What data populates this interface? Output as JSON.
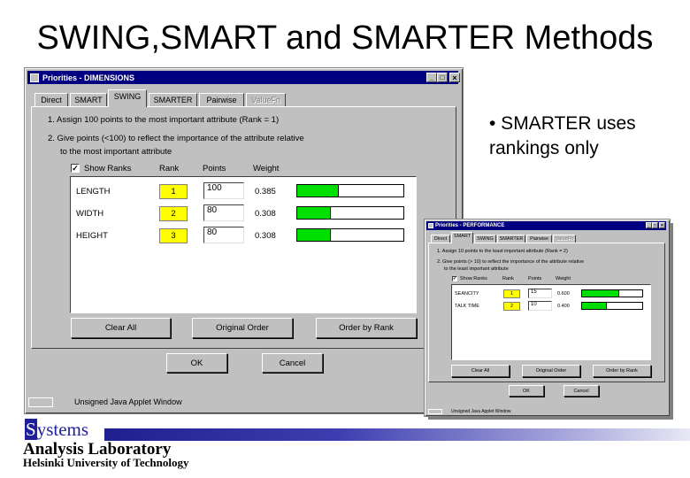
{
  "slide": {
    "title": "SWING,SMART and SMARTER Methods",
    "bullet": "• SMARTER uses rankings only"
  },
  "large_window": {
    "title": "Priorities - DIMENSIONS",
    "controls": [
      "_",
      "□",
      "×"
    ],
    "tabs": [
      {
        "label": "Direct",
        "state": "normal"
      },
      {
        "label": "SMART",
        "state": "normal"
      },
      {
        "label": "SWING",
        "state": "active"
      },
      {
        "label": "SMARTER",
        "state": "normal"
      },
      {
        "label": "Pairwise",
        "state": "normal"
      },
      {
        "label": "ValueFn",
        "state": "disabled"
      }
    ],
    "instructions": [
      "1. Assign 100 points to the most important attribute (Rank = 1)",
      "2. Give points (<100) to reflect the importance of the attribute relative",
      "to the most important attribute"
    ],
    "show_ranks_checked": true,
    "show_ranks_label": "Show Ranks",
    "col_rank": "Rank",
    "col_points": "Points",
    "col_weight": "Weight",
    "rows": [
      {
        "name": "LENGTH",
        "rank": "1",
        "points": "100",
        "weight": "0.385",
        "weight_value": 0.385
      },
      {
        "name": "WIDTH",
        "rank": "2",
        "points": "80",
        "weight": "0.308",
        "weight_value": 0.308
      },
      {
        "name": "HEIGHT",
        "rank": "3",
        "points": "80",
        "weight": "0.308",
        "weight_value": 0.308
      }
    ],
    "btn_clear": "Clear All",
    "btn_original": "Original Order",
    "btn_order_rank": "Order by Rank",
    "btn_ok": "OK",
    "btn_cancel": "Cancel",
    "status": "Unsigned Java Applet Window"
  },
  "small_window": {
    "title": "Priorities - PERFORMANCE",
    "controls": [
      "_",
      "□",
      "×"
    ],
    "tabs": [
      {
        "label": "Direct",
        "state": "normal"
      },
      {
        "label": "SMART",
        "state": "active"
      },
      {
        "label": "SWING",
        "state": "normal"
      },
      {
        "label": "SMARTER",
        "state": "normal"
      },
      {
        "label": "Pairwise",
        "state": "normal"
      },
      {
        "label": "ValueFn",
        "state": "disabled"
      }
    ],
    "instructions": [
      "1. Assign 10 points to the least important attribute (Rank = 2)",
      "2. Give points (> 10) to reflect the importance of the attribute relative",
      "to the least important attribute"
    ],
    "show_ranks_checked": true,
    "show_ranks_label": "Show Ranks",
    "col_rank": "Rank",
    "col_points": "Points",
    "col_weight": "Weight",
    "rows": [
      {
        "name": "SEANCITY",
        "rank": "1",
        "points": "15",
        "weight": "0.600",
        "weight_value": 0.6
      },
      {
        "name": "TALK TIME",
        "rank": "2",
        "points": "10",
        "weight": "0.400",
        "weight_value": 0.4
      }
    ],
    "btn_clear": "Clear All",
    "btn_original": "Original Order",
    "btn_order_rank": "Order by Rank",
    "btn_ok": "OK",
    "btn_cancel": "Cancel",
    "status": "Unsigned Java Applet Window"
  },
  "logo": {
    "systems_cap": "S",
    "systems_rest": "ystems",
    "lab": "Analysis Laboratory",
    "university": "Helsinki University of Technology"
  }
}
